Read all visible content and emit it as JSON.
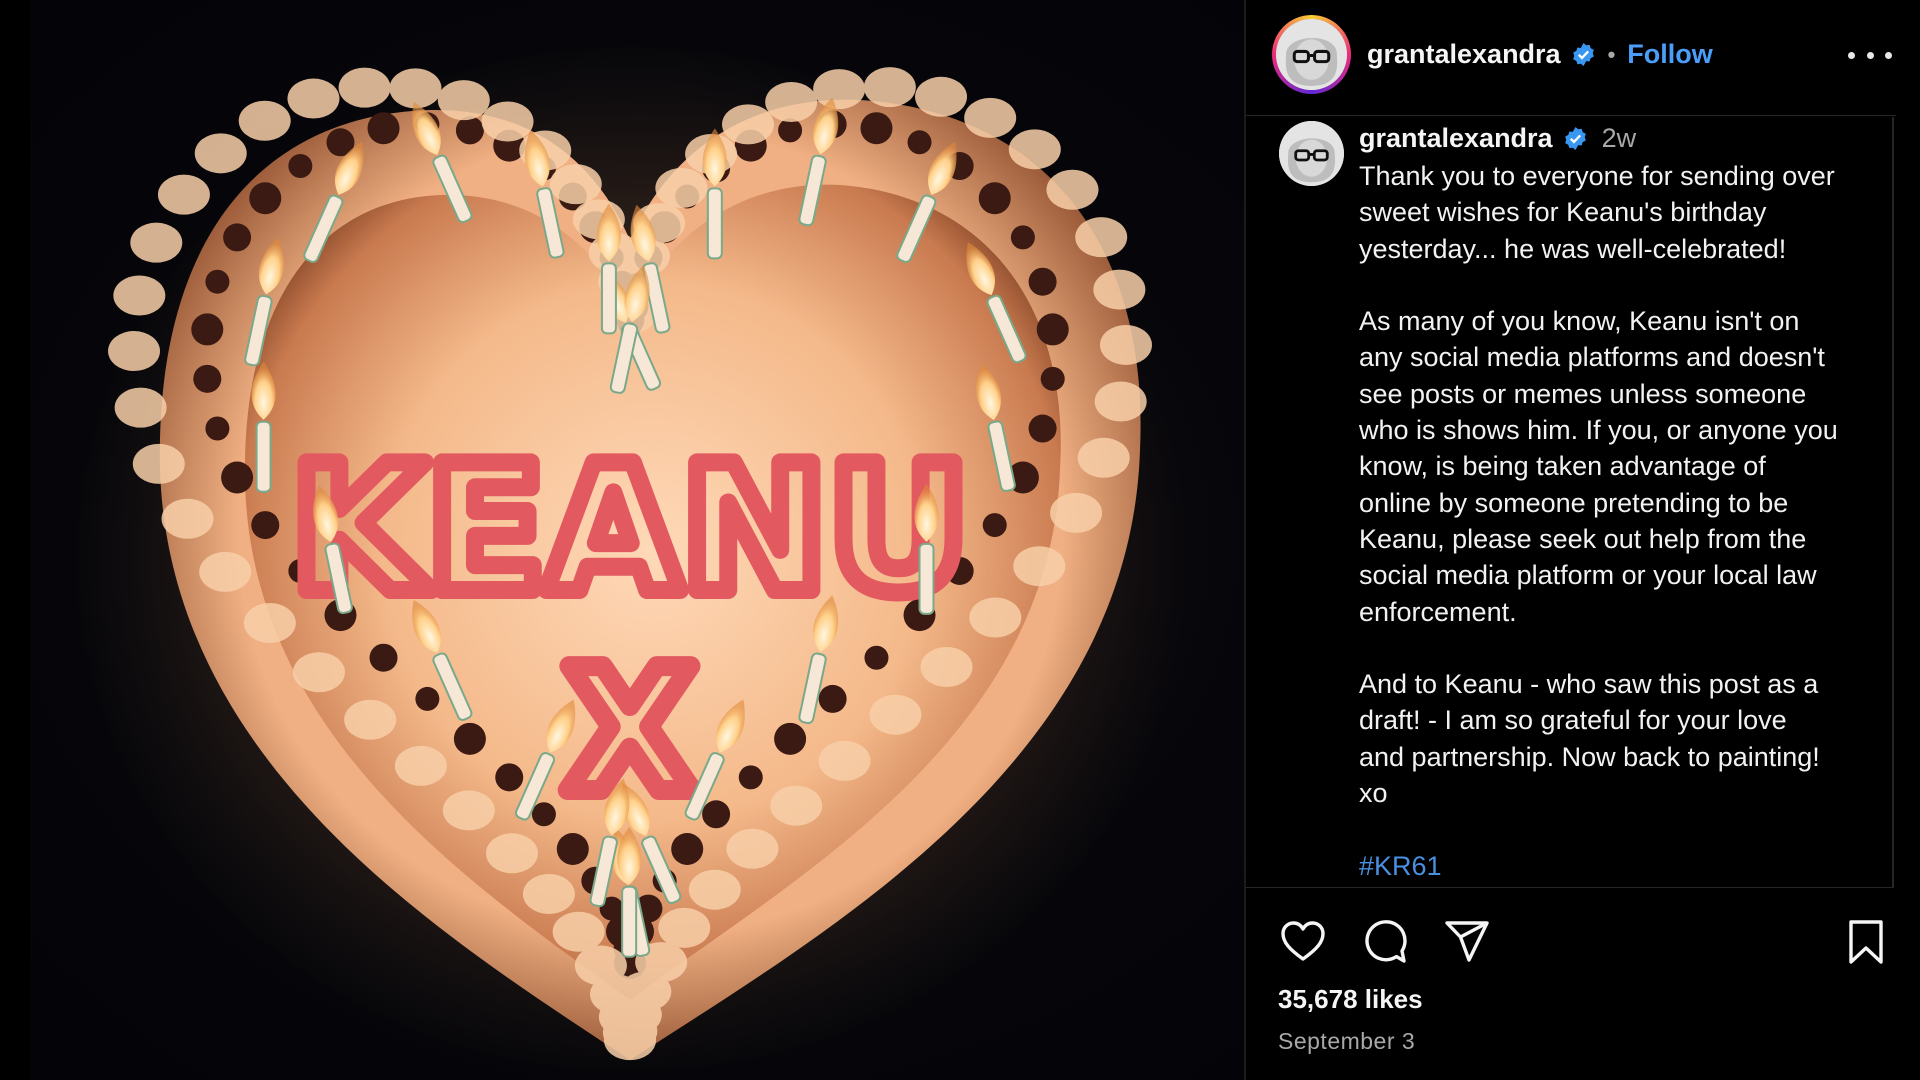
{
  "post": {
    "username": "grantalexandra",
    "follow_label": "Follow",
    "separator": "•",
    "time_ago": "2w",
    "caption_paragraphs": [
      [
        "Thank you to everyone for sending over",
        "sweet wishes for Keanu's birthday",
        "yesterday... he was well-celebrated!"
      ],
      [
        "As many of you know, Keanu isn't on",
        "any social media platforms and doesn't",
        "see posts or memes unless someone",
        "who is shows him. If you, or anyone you",
        "know, is being taken advantage of",
        "online by someone pretending to be",
        "Keanu, please seek out help from the",
        "social media platform or your local law",
        "enforcement."
      ],
      [
        "And to Keanu - who saw this post as a",
        "draft! - I am so grateful for your love",
        "and partnership. Now back to painting!",
        "xo"
      ]
    ],
    "hashtag": "#KR61",
    "likes": "35,678 likes",
    "date": "September 3"
  },
  "media": {
    "cake_text": "KEANU",
    "cake_kiss": "X"
  },
  "icons": {
    "verified": "verified-badge-icon",
    "more": "more-options-icon",
    "like": "heart-icon",
    "comment": "comment-icon",
    "share": "send-icon",
    "save": "bookmark-icon"
  },
  "colors": {
    "link_blue": "#4a9df8",
    "verified_blue": "#3897f0",
    "muted": "#a8a8a8",
    "cake_icing": "#e86a6a"
  }
}
